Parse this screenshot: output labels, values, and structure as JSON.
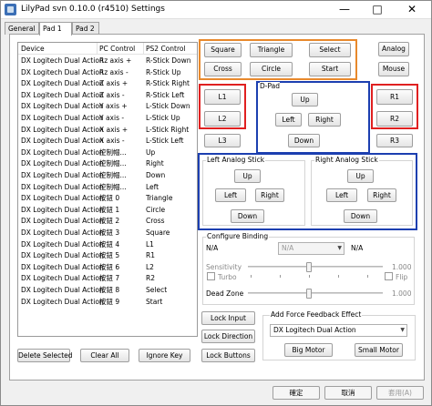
{
  "window": {
    "title": "LilyPad svn 0.10.0 (r4510) Settings",
    "minimize_icon": "minimize-icon",
    "maximize_icon": "maximize-icon",
    "close_icon": "close-icon"
  },
  "tabs": [
    {
      "label": "General",
      "active": false
    },
    {
      "label": "Pad 1",
      "active": true
    },
    {
      "label": "Pad 2",
      "active": false
    }
  ],
  "bindings_list": {
    "columns": [
      "Device",
      "PC Control",
      "PS2 Control"
    ],
    "rows": [
      {
        "device": "DX Logitech Dual Action",
        "pc": "Rz axis +",
        "ps2": "R-Stick Down"
      },
      {
        "device": "DX Logitech Dual Action",
        "pc": "Rz axis -",
        "ps2": "R-Stick Up"
      },
      {
        "device": "DX Logitech Dual Action",
        "pc": "Z axis +",
        "ps2": "R-Stick Right"
      },
      {
        "device": "DX Logitech Dual Action",
        "pc": "Z axis -",
        "ps2": "R-Stick Left"
      },
      {
        "device": "DX Logitech Dual Action",
        "pc": "Y axis +",
        "ps2": "L-Stick Down"
      },
      {
        "device": "DX Logitech Dual Action",
        "pc": "Y axis -",
        "ps2": "L-Stick Up"
      },
      {
        "device": "DX Logitech Dual Action",
        "pc": "X axis +",
        "ps2": "L-Stick Right"
      },
      {
        "device": "DX Logitech Dual Action",
        "pc": "X axis -",
        "ps2": "L-Stick Left"
      },
      {
        "device": "DX Logitech Dual Action",
        "pc": "控制帽...",
        "ps2": "Up"
      },
      {
        "device": "DX Logitech Dual Action",
        "pc": "控制帽...",
        "ps2": "Right"
      },
      {
        "device": "DX Logitech Dual Action",
        "pc": "控制帽...",
        "ps2": "Down"
      },
      {
        "device": "DX Logitech Dual Action",
        "pc": "控制帽...",
        "ps2": "Left"
      },
      {
        "device": "DX Logitech Dual Action",
        "pc": "按鈕 0",
        "ps2": "Triangle"
      },
      {
        "device": "DX Logitech Dual Action",
        "pc": "按鈕 1",
        "ps2": "Circle"
      },
      {
        "device": "DX Logitech Dual Action",
        "pc": "按鈕 2",
        "ps2": "Cross"
      },
      {
        "device": "DX Logitech Dual Action",
        "pc": "按鈕 3",
        "ps2": "Square"
      },
      {
        "device": "DX Logitech Dual Action",
        "pc": "按鈕 4",
        "ps2": "L1"
      },
      {
        "device": "DX Logitech Dual Action",
        "pc": "按鈕 5",
        "ps2": "R1"
      },
      {
        "device": "DX Logitech Dual Action",
        "pc": "按鈕 6",
        "ps2": "L2"
      },
      {
        "device": "DX Logitech Dual Action",
        "pc": "按鈕 7",
        "ps2": "R2"
      },
      {
        "device": "DX Logitech Dual Action",
        "pc": "按鈕 8",
        "ps2": "Select"
      },
      {
        "device": "DX Logitech Dual Action",
        "pc": "按鈕 9",
        "ps2": "Start"
      }
    ]
  },
  "face_buttons": {
    "square": "Square",
    "triangle": "Triangle",
    "select": "Select",
    "cross": "Cross",
    "circle": "Circle",
    "start": "Start"
  },
  "side_buttons": {
    "analog": "Analog",
    "mouse": "Mouse"
  },
  "shoulder_buttons": {
    "l1": "L1",
    "l2": "L2",
    "l3": "L3",
    "r1": "R1",
    "r2": "R2",
    "r3": "R3"
  },
  "dpad": {
    "title": "D-Pad",
    "up": "Up",
    "left": "Left",
    "right": "Right",
    "down": "Down"
  },
  "left_stick": {
    "title": "Left Analog Stick",
    "up": "Up",
    "left": "Left",
    "right": "Right",
    "down": "Down"
  },
  "right_stick": {
    "title": "Right Analog Stick",
    "up": "Up",
    "left": "Left",
    "right": "Right",
    "down": "Down"
  },
  "configure_binding": {
    "title": "Configure Binding",
    "left_na": "N/A",
    "combo_value": "N/A",
    "right_na": "N/A",
    "sensitivity_label": "Sensitivity",
    "sensitivity_value": "1.000",
    "turbo_label": "Turbo",
    "flip_label": "Flip",
    "deadzone_label": "Dead Zone",
    "deadzone_value": "1.000"
  },
  "lock_buttons": {
    "input": "Lock Input",
    "direction": "Lock Direction",
    "buttons": "Lock Buttons"
  },
  "force_feedback": {
    "title": "Add Force Feedback Effect",
    "device": "DX Logitech Dual Action",
    "big_motor": "Big Motor",
    "small_motor": "Small Motor"
  },
  "list_actions": {
    "delete": "Delete Selected",
    "clear": "Clear All",
    "ignore": "Ignore Key"
  },
  "dialog": {
    "ok": "確定",
    "cancel": "取消",
    "apply": "套用(A)"
  },
  "colors": {
    "orange": "#e8892c",
    "red": "#e02020",
    "blue": "#1c3fb0"
  }
}
